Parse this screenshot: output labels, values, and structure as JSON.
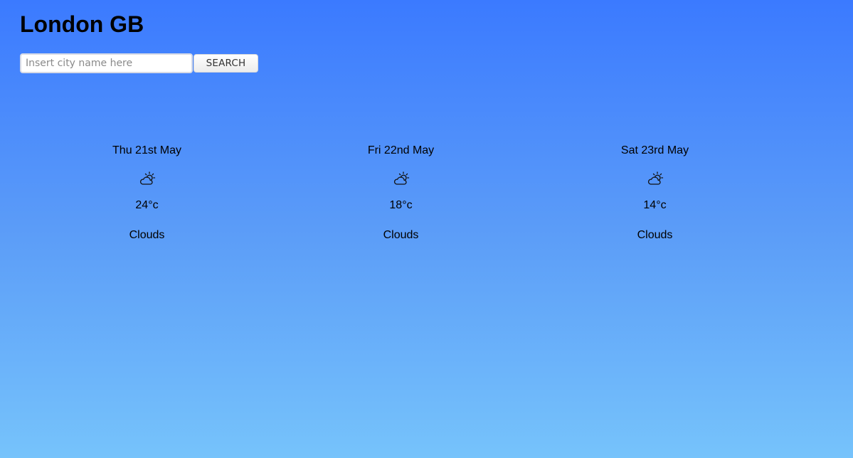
{
  "header": {
    "city": "London GB"
  },
  "search": {
    "placeholder": "Insert city name here",
    "value": "",
    "button_label": "SEARCH"
  },
  "forecast": [
    {
      "date": "Thu 21st May",
      "icon": "cloud-sun-icon",
      "temp": "24°c",
      "description": "Clouds"
    },
    {
      "date": "Fri 22nd May",
      "icon": "cloud-sun-icon",
      "temp": "18°c",
      "description": "Clouds"
    },
    {
      "date": "Sat 23rd May",
      "icon": "cloud-sun-icon",
      "temp": "14°c",
      "description": "Clouds"
    }
  ],
  "colors": {
    "background_top": "#3b7aff",
    "background_bottom": "#76c3fb"
  }
}
